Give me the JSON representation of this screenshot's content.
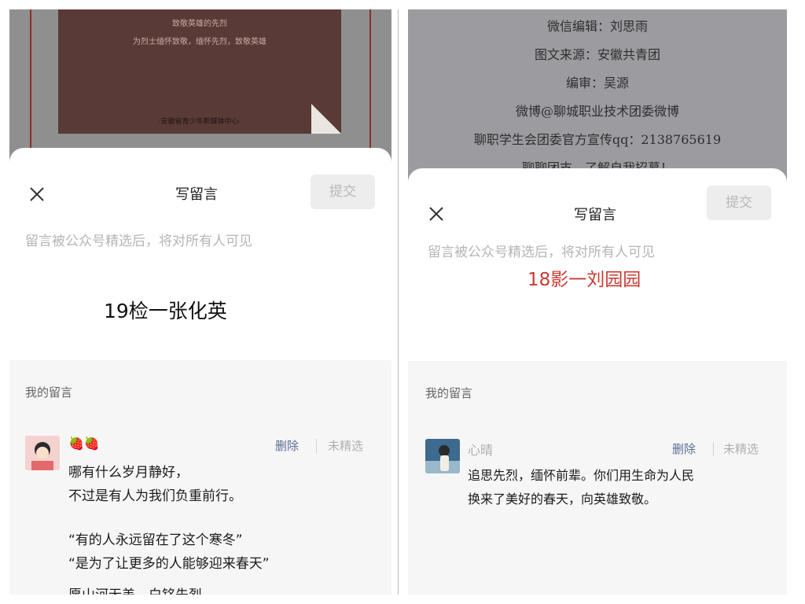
{
  "left": {
    "poster": {
      "line1": "致敬英雄的先烈",
      "line2": "为烈士缅怀致敬，缅怀先烈，致敬英雄",
      "footer": "·安徽省青少年新媒体中心·"
    },
    "sheet": {
      "close_icon": "close-icon",
      "title": "写留言",
      "submit_label": "提交",
      "hint": "留言被公众号精选后，将对所有人可见",
      "draft_text": "19检一张化英"
    },
    "my_comments": {
      "label": "我的留言",
      "nickname": "🍓🍓",
      "delete_label": "删除",
      "status": "未精选",
      "lines": [
        "哪有什么岁月静好，",
        "不过是有人为我们负重前行。",
        "",
        "“有的人永远留在了这个寒冬”",
        "“是为了让更多的人能够迎来春天”",
        "愿山河无恙，白铭先烈"
      ]
    }
  },
  "right": {
    "article": {
      "lines": [
        "微信编辑：刘思雨",
        "图文来源：安徽共青团",
        "编审：吴源",
        "微博@聊城职业技术团委微博",
        "聊职学生会团委官方宣传qq：2138765619",
        "聊聊团支，了解自我招募！"
      ]
    },
    "sheet": {
      "close_icon": "close-icon",
      "title": "写留言",
      "submit_label": "提交",
      "hint": "留言被公众号精选后，将对所有人可见",
      "draft_text": "18影一刘园园"
    },
    "my_comments": {
      "label": "我的留言",
      "nickname": "心晴",
      "delete_label": "删除",
      "status": "未精选",
      "lines": [
        "追思先烈，缅怀前辈。你们用生命为人民",
        "换来了美好的春天，向英雄致敬。"
      ]
    }
  },
  "colors": {
    "poster": "#5a3a36",
    "frame": "#8c2e2a",
    "delete_link": "#5a6d96",
    "draft_red": "#c93a32",
    "hint": "#b5b5b5"
  }
}
